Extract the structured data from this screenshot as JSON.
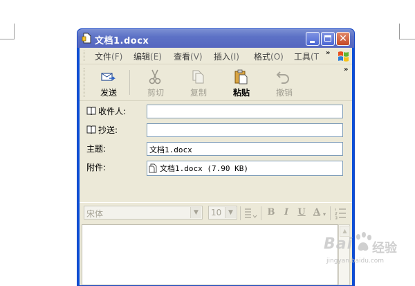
{
  "window": {
    "title": "文档1.docx",
    "title_icon": "document-icon"
  },
  "menu": {
    "items": [
      {
        "label": "文件",
        "accel": "(F)"
      },
      {
        "label": "编辑",
        "accel": "(E)"
      },
      {
        "label": "查看",
        "accel": "(V)"
      },
      {
        "label": "插入",
        "accel": "(I)"
      },
      {
        "label": "格式",
        "accel": "(O)"
      },
      {
        "label": "工具",
        "accel": "(T"
      }
    ],
    "overflow": "»"
  },
  "toolbar": {
    "send": "发送",
    "cut": "剪切",
    "copy": "复制",
    "paste": "粘贴",
    "undo": "撤销",
    "overflow": "»"
  },
  "fields": {
    "to_label": "收件人:",
    "cc_label": "抄送:",
    "subject_label": "主题:",
    "attach_label": "附件:",
    "to_value": "",
    "cc_value": "",
    "subject_value": "文档1.docx",
    "attachment_value": "文档1.docx (7.90 KB)"
  },
  "format": {
    "font": "宋体",
    "size": "10",
    "bold": "B",
    "italic": "I",
    "underline": "U",
    "font_color": "A"
  },
  "watermark": {
    "brand": "Bai",
    "brand_cn": "经验",
    "url": "jingyan.baidu.com"
  },
  "colors": {
    "titlebar": "#5d72c6",
    "client": "#ece9d8",
    "close_button": "#c54a27"
  }
}
